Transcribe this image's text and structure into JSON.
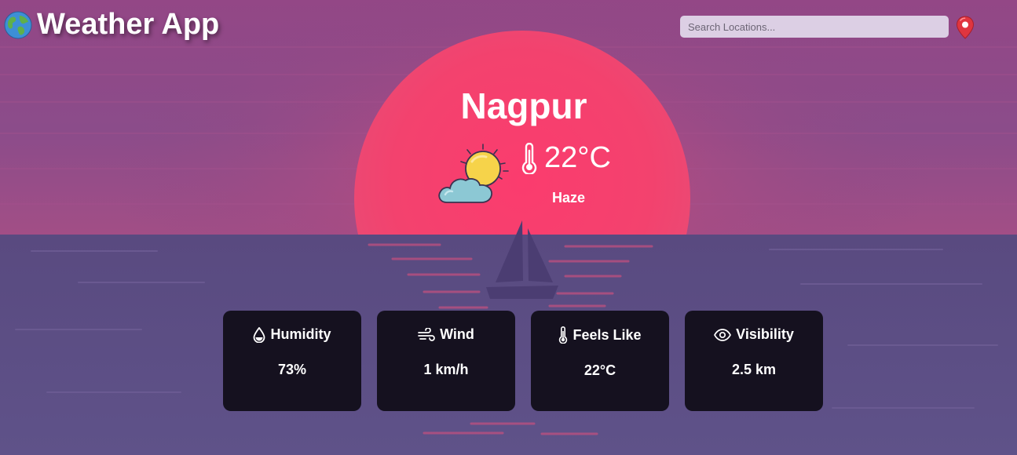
{
  "header": {
    "app_title": "Weather App",
    "logo_icon": "globe-icon",
    "search": {
      "placeholder": "Search Locations...",
      "value": ""
    },
    "location_icon": "map-pin-icon"
  },
  "current": {
    "city": "Nagpur",
    "temperature": "22°C",
    "condition": "Haze",
    "weather_icon": "sun-behind-cloud-icon",
    "temperature_icon": "thermometer-icon"
  },
  "metrics": [
    {
      "label": "Humidity",
      "value": "73%",
      "icon": "droplet-icon"
    },
    {
      "label": "Wind",
      "value": "1 km/h",
      "icon": "wind-icon"
    },
    {
      "label": "Feels Like",
      "value": "22°C",
      "icon": "thermometer-icon"
    },
    {
      "label": "Visibility",
      "value": "2.5 km",
      "icon": "eye-icon"
    }
  ],
  "colors": {
    "sky": "#8a4a86",
    "sun": "#f2406e",
    "sea": "#5a4d84",
    "card_background": "#15111f",
    "pin": "#e0353f"
  }
}
